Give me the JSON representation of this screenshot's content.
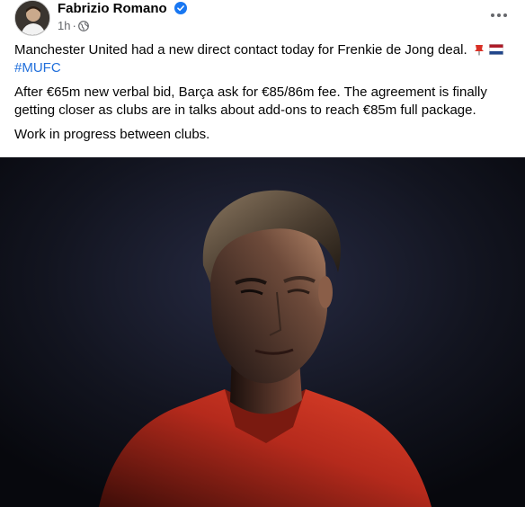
{
  "post": {
    "author": "Fabrizio Romano",
    "time": "1h",
    "time_separator": "·",
    "paragraph1": "Manchester United had a new direct contact today for Frenkie de Jong deal.",
    "hashtag": "#MUFC",
    "paragraph2": "After €65m new verbal bid, Barça ask for €85/86m fee. The agreement is finally getting closer as clubs are in talks about add-ons to reach €85m full package.",
    "paragraph3": "Work in progress between clubs."
  },
  "colors": {
    "hashtag": "#216fdb",
    "verified": "#1877f2",
    "muted": "#65676b",
    "jersey": "#c8321e"
  },
  "icons": [
    "verified-badge-icon",
    "globe-icon",
    "more-options-icon",
    "red-pin-icon",
    "netherlands-flag-icon"
  ]
}
